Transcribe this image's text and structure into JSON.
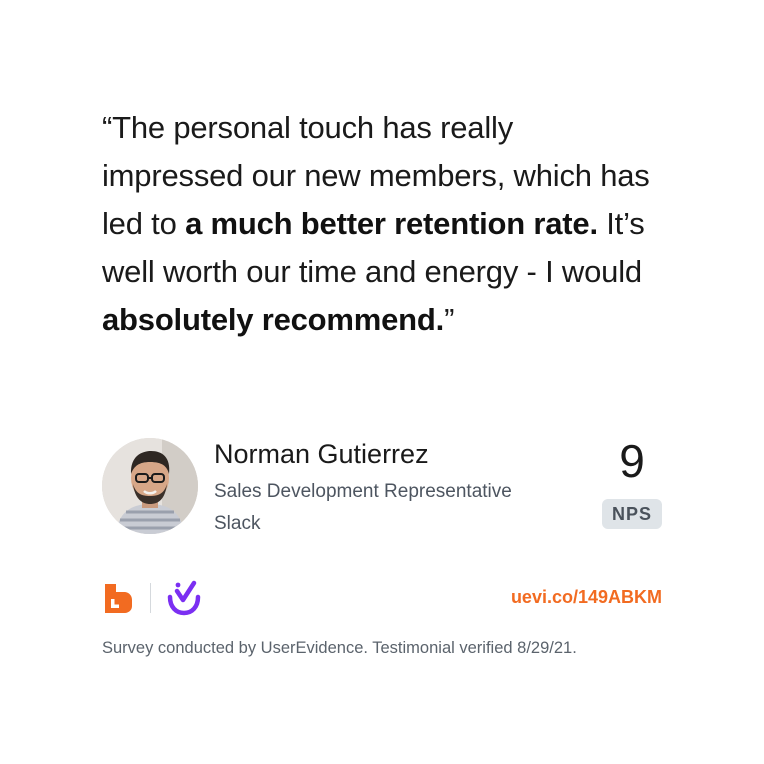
{
  "quote": {
    "open_mark": "“",
    "part1": "The personal touch has really impressed our new members, which has led to ",
    "bold1": "a much better retention rate.",
    "part2": " It’s well worth our time and energy - I would ",
    "bold2": "absolutely recommend.",
    "close_mark": "”"
  },
  "person": {
    "name": "Norman Gutierrez",
    "role": "Sales Development Representative",
    "company": "Slack"
  },
  "nps": {
    "score": "9",
    "label": "NPS"
  },
  "logos": {
    "brand_logo": "orange-b-logo-icon",
    "verified_logo": "purple-check-logo-icon"
  },
  "link": {
    "text": "uevi.co/149ABKM"
  },
  "footer": {
    "text": "Survey conducted by UserEvidence. Testimonial verified 8/29/21."
  },
  "colors": {
    "accent_orange": "#f26b21",
    "accent_purple": "#7b2ff2",
    "badge_bg": "#dfe4e8"
  }
}
